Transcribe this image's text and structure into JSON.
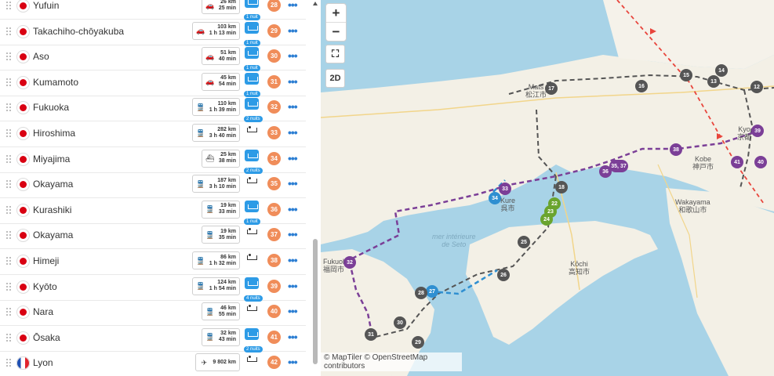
{
  "itinerary": [
    {
      "city": "Yufuin",
      "flag": "jp",
      "mode": "car",
      "km": "26 km",
      "time": "25 min",
      "nights": "1 nuit",
      "num": "28"
    },
    {
      "city": "Takachiho-chōyakuba",
      "flag": "jp",
      "mode": "car",
      "km": "103 km",
      "time": "1 h 13 min",
      "nights": "1 nuit",
      "num": "29"
    },
    {
      "city": "Aso",
      "flag": "jp",
      "mode": "car",
      "km": "51 km",
      "time": "40 min",
      "nights": "1 nuit",
      "num": "30"
    },
    {
      "city": "Kumamoto",
      "flag": "jp",
      "mode": "car",
      "km": "45 km",
      "time": "54 min",
      "nights": "1 nuit",
      "num": "31"
    },
    {
      "city": "Fukuoka",
      "flag": "jp",
      "mode": "train",
      "km": "110 km",
      "time": "1 h 39 min",
      "nights": "2 nuits",
      "num": "32"
    },
    {
      "city": "Hiroshima",
      "flag": "jp",
      "mode": "train",
      "km": "282 km",
      "time": "3 h 40 min",
      "nights": "",
      "num": "33"
    },
    {
      "city": "Miyajima",
      "flag": "jp",
      "mode": "ferry",
      "km": "25 km",
      "time": "38 min",
      "nights": "2 nuits",
      "num": "34"
    },
    {
      "city": "Okayama",
      "flag": "jp",
      "mode": "train",
      "km": "187 km",
      "time": "3 h 10 min",
      "nights": "",
      "num": "35"
    },
    {
      "city": "Kurashiki",
      "flag": "jp",
      "mode": "train",
      "km": "19 km",
      "time": "33 min",
      "nights": "1 nuit",
      "num": "36"
    },
    {
      "city": "Okayama",
      "flag": "jp",
      "mode": "train",
      "km": "19 km",
      "time": "35 min",
      "nights": "",
      "num": "37"
    },
    {
      "city": "Himeji",
      "flag": "jp",
      "mode": "train",
      "km": "86 km",
      "time": "1 h 32 min",
      "nights": "",
      "num": "38"
    },
    {
      "city": "Kyōto",
      "flag": "jp",
      "mode": "train",
      "km": "124 km",
      "time": "1 h 54 min",
      "nights": "4 nuits",
      "num": "39"
    },
    {
      "city": "Nara",
      "flag": "jp",
      "mode": "train",
      "km": "46 km",
      "time": "55 min",
      "nights": "",
      "num": "40"
    },
    {
      "city": "Ōsaka",
      "flag": "jp",
      "mode": "train",
      "km": "32 km",
      "time": "43 min",
      "nights": "2 nuits",
      "num": "41"
    },
    {
      "city": "Lyon",
      "flag": "fr",
      "mode": "plane",
      "km": "9 802 km",
      "time": "",
      "nights": "",
      "num": "42"
    }
  ],
  "more_label": "•••",
  "icons": {
    "car": "car-icon",
    "train": "train-icon",
    "ferry": "ferry-icon",
    "plane": "plane-icon",
    "stay": "bed-icon",
    "handle": "drag-handle-icon"
  },
  "colors": {
    "stage": "#f08d5a",
    "stay": "#2d9be6",
    "link": "#2d7fd3",
    "route_purple": "#7b3f97",
    "route_dark": "#555555",
    "route_green": "#6aa42e",
    "route_blue": "#2f8fd1",
    "flight": "#e8453c"
  },
  "map": {
    "zoom_in": "+",
    "zoom_out": "−",
    "fullscreen_icon": "⛶",
    "mode": "2D",
    "attribution": "© MapTiler © OpenStreetMap contributors",
    "labels": {
      "matsue": "Mats",
      "matsue_jp": "松江市",
      "kyoto": "Kyo",
      "kyoto_jp": "京都",
      "kobe": "Kobe",
      "kobe_jp": "神戸市",
      "wakayama": "Wakayama",
      "wakayama_jp": "和歌山市",
      "kure": "Kure",
      "kure_jp": "呉市",
      "sea1": "mer intérieure",
      "sea2": "de Seto",
      "kochi": "Kōchi",
      "kochi_jp": "高知市",
      "fukuoka": "Fukuol",
      "fukuoka_jp": "福岡市"
    },
    "markers": {
      "m12": "12",
      "m13": "13",
      "m14": "14",
      "m15": "15",
      "m16": "16",
      "m17": "17",
      "m18": "18",
      "m22": "22",
      "m23": "23",
      "m24": "24",
      "m25": "25",
      "m26": "26",
      "m27": "27",
      "m28": "28",
      "m29": "29",
      "m30": "30",
      "m31": "31",
      "m32": "32",
      "m33": "33",
      "m34": "34",
      "m3537": "35, 37",
      "m36": "36",
      "m38": "38",
      "m39": "39",
      "m40": "40",
      "m41": "41"
    }
  }
}
